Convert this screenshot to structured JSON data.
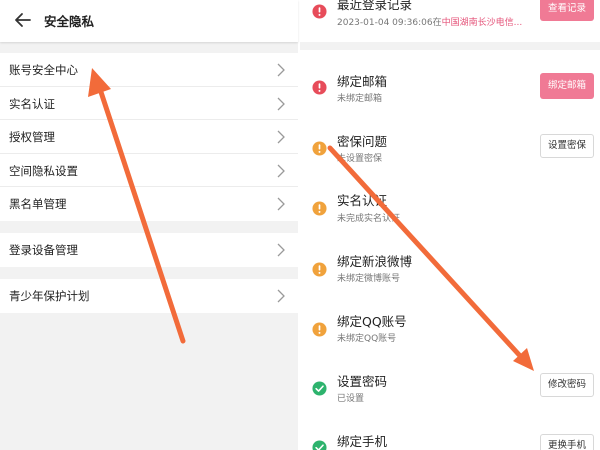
{
  "left": {
    "header": {
      "title": "安全隐私"
    },
    "menu_group_1": [
      {
        "label": "账号安全中心"
      },
      {
        "label": "实名认证"
      },
      {
        "label": "授权管理"
      },
      {
        "label": "空间隐私设置"
      },
      {
        "label": "黑名单管理"
      }
    ],
    "menu_group_2": [
      {
        "label": "登录设备管理"
      }
    ],
    "menu_group_3": [
      {
        "label": "青少年保护计划"
      }
    ]
  },
  "right": {
    "login_record": {
      "title": "最近登录记录",
      "datetime": "2023-01-04 09:36:06在",
      "location": "中国湖南长沙电信...",
      "button": "查看记录"
    },
    "items": [
      {
        "title": "绑定邮箱",
        "subtitle": "未绑定邮箱",
        "status": "error",
        "button": "绑定邮箱",
        "button_style": "pink"
      },
      {
        "title": "密保问题",
        "subtitle": "未设置密保",
        "status": "warning",
        "button": "设置密保",
        "button_style": "outline"
      },
      {
        "title": "实名认证",
        "subtitle": "未完成实名认证",
        "status": "warning"
      },
      {
        "title": "绑定新浪微博",
        "subtitle": "未绑定微博账号",
        "status": "warning"
      },
      {
        "title": "绑定QQ账号",
        "subtitle": "未绑定QQ账号",
        "status": "warning"
      },
      {
        "title": "设置密码",
        "subtitle": "已设置",
        "status": "ok",
        "button": "修改密码",
        "button_style": "outline"
      },
      {
        "title": "绑定手机",
        "subtitle": "",
        "status": "ok",
        "button": "更换手机",
        "button_style": "outline"
      }
    ]
  },
  "colors": {
    "error": "#e74c5a",
    "warning": "#f0a23c",
    "ok": "#2db36d",
    "accent_pink": "#f07a95",
    "annotation_arrow": "#f26b3a"
  },
  "icons": {
    "back": "arrow-left-icon",
    "chevron": "chevron-right-icon",
    "error": "exclamation-circle-icon",
    "warning": "exclamation-circle-icon",
    "ok": "check-circle-icon"
  }
}
